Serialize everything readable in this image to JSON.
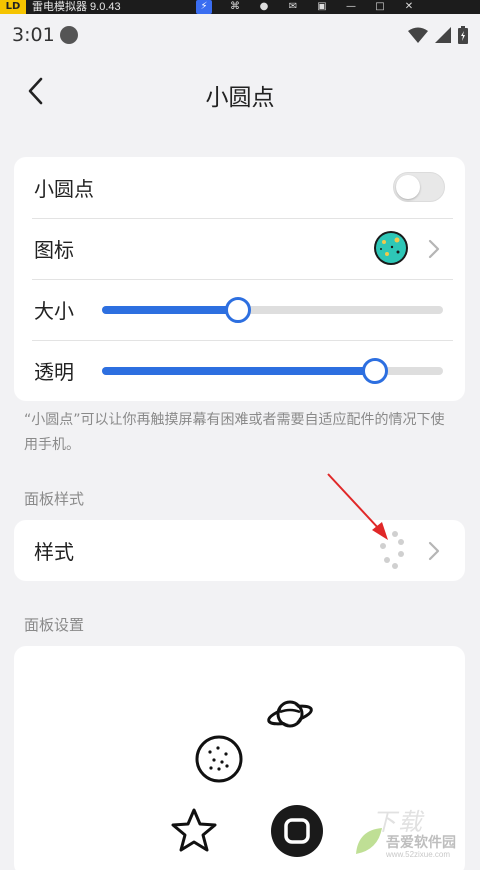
{
  "emulator": {
    "logo": "LD",
    "title": "雷电模拟器 9.0.43",
    "icons": [
      "bolt-icon",
      "gamepad-icon",
      "user-icon",
      "mail-icon",
      "gift-icon",
      "minimize-icon",
      "maximize-icon",
      "close-icon"
    ]
  },
  "status_bar": {
    "time": "3:01"
  },
  "header": {
    "title": "小圆点"
  },
  "settings": {
    "toggle_label": "小圆点",
    "toggle_on": false,
    "icon_label": "图标",
    "size_label": "大小",
    "size_value": 0.4,
    "opacity_label": "透明",
    "opacity_value": 0.8
  },
  "description": "“小圆点”可以让你再触摸屏幕有困难或者需要自适应配件的情况下使用手机。",
  "panel_style": {
    "section_title": "面板样式",
    "row_label": "样式"
  },
  "panel_settings": {
    "section_title": "面板设置",
    "items": [
      "planet-icon",
      "cookie-icon",
      "star-icon",
      "home-button-icon"
    ]
  },
  "watermark": {
    "text": "吾爱软件园",
    "url": "www.52zixue.com",
    "top": "下载"
  },
  "colors": {
    "accent": "#2d6fe0",
    "background": "#f2f2f4",
    "card": "#ffffff",
    "annotation_arrow": "#e02828"
  }
}
